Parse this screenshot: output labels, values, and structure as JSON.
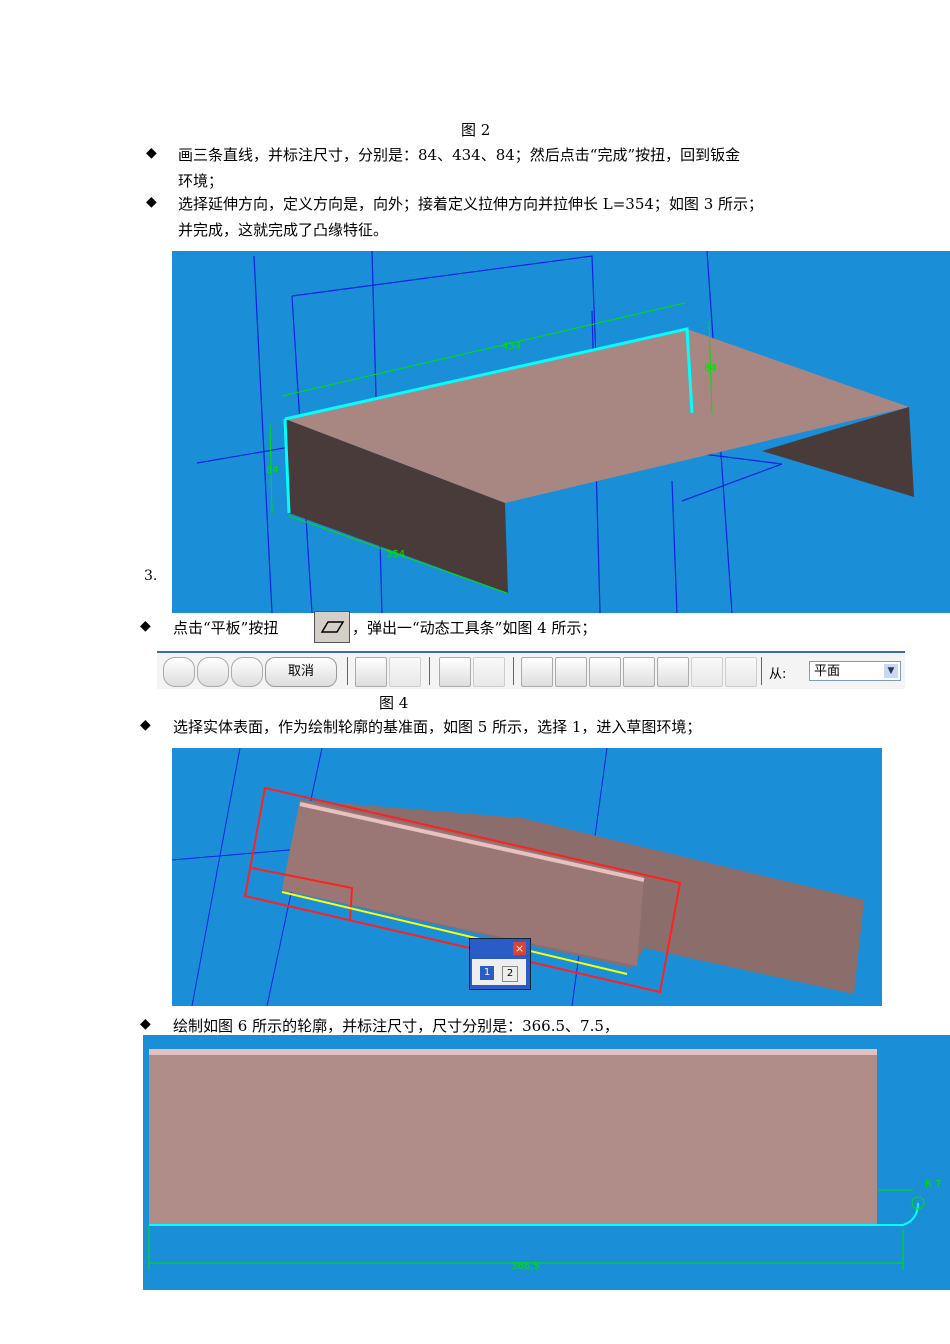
{
  "captions": {
    "fig2": "图 2",
    "fig3_number": "3.",
    "fig4": "图 4"
  },
  "paragraphs": [
    {
      "line1": "画三条直线，并标注尺寸，分别是：84、434、84；然后点击“完成”按扭，回到钣金",
      "line2": "环境；"
    },
    {
      "line1": "选择延伸方向，定义方向是，向外；接着定义拉伸方向并拉伸长 L=354；如图 3 所示；",
      "line2": "并完成，这就完成了凸缘特征。"
    },
    {
      "before": "点击“平板”按扭",
      "after": "，弹出一“动态工具条”如图 4 所示；"
    },
    {
      "line1": "选择实体表面，作为绘制轮廓的基准面，如图 5 所示，选择 1，进入草图环境；"
    },
    {
      "line1": "绘制如图 6 所示的轮廓，并标注尺寸，尺寸分别是：366.5、7.5，"
    }
  ],
  "bullet": "◆",
  "fig3_dims": {
    "top": "434",
    "left": "84",
    "right": "84",
    "bottom": "354"
  },
  "toolbar": {
    "cancel": "取消",
    "from_label": "从:",
    "from_value": "平面"
  },
  "fig5_popup": {
    "opt1": "1",
    "opt2": "2",
    "close": "×"
  },
  "fig6_dims": {
    "length": "366,5",
    "radius": "R 7"
  },
  "colors": {
    "background": "#1a8fd8",
    "solid": "#a88783",
    "dim": "#00e000",
    "edge": "#00ffff"
  }
}
